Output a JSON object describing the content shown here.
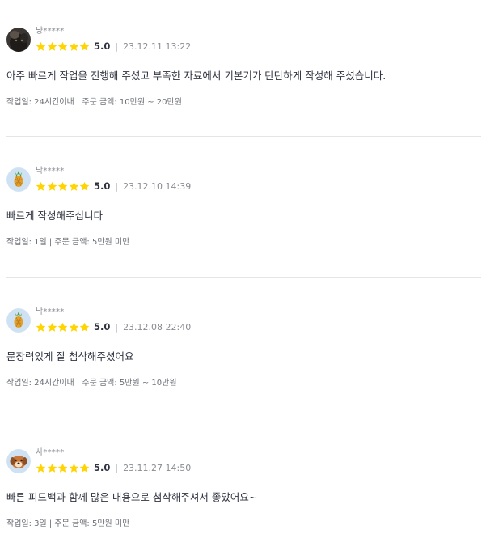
{
  "colors": {
    "star": "#ffd400",
    "divider": "#e4e5e7",
    "text": "#303441",
    "muted": "#8a8c93"
  },
  "reviews": [
    {
      "nickname": "냥*****",
      "avatar_icon": "black-cat-avatar",
      "rating": 5.0,
      "score_label": "5.0",
      "separator": "|",
      "date": "23.12.11 13:22",
      "comment": "아주 빠르게 작업을 진행해 주셨고 부족한 자료에서 기본기가 탄탄하게 작성해 주셨습니다.",
      "meta": "작업일: 24시간이내 | 주문 금액: 10만원 ~ 20만원"
    },
    {
      "nickname": "낙*****",
      "avatar_icon": "pineapple-avatar",
      "rating": 5.0,
      "score_label": "5.0",
      "separator": "|",
      "date": "23.12.10 14:39",
      "comment": "빠르게 작성해주십니다",
      "meta": "작업일: 1일 | 주문 금액: 5만원 미만"
    },
    {
      "nickname": "낙*****",
      "avatar_icon": "pineapple-avatar",
      "rating": 5.0,
      "score_label": "5.0",
      "separator": "|",
      "date": "23.12.08 22:40",
      "comment": "문장력있게 잘 첨삭해주셨어요",
      "meta": "작업일: 24시간이내 | 주문 금액: 5만원 ~ 10만원"
    },
    {
      "nickname": "사*****",
      "avatar_icon": "dog-avatar",
      "rating": 5.0,
      "score_label": "5.0",
      "separator": "|",
      "date": "23.11.27 14:50",
      "comment": "빠른 피드백과 함께 많은 내용으로 첨삭해주셔서 좋았어요~",
      "meta": "작업일: 3일 | 주문 금액: 5만원 미만"
    }
  ]
}
